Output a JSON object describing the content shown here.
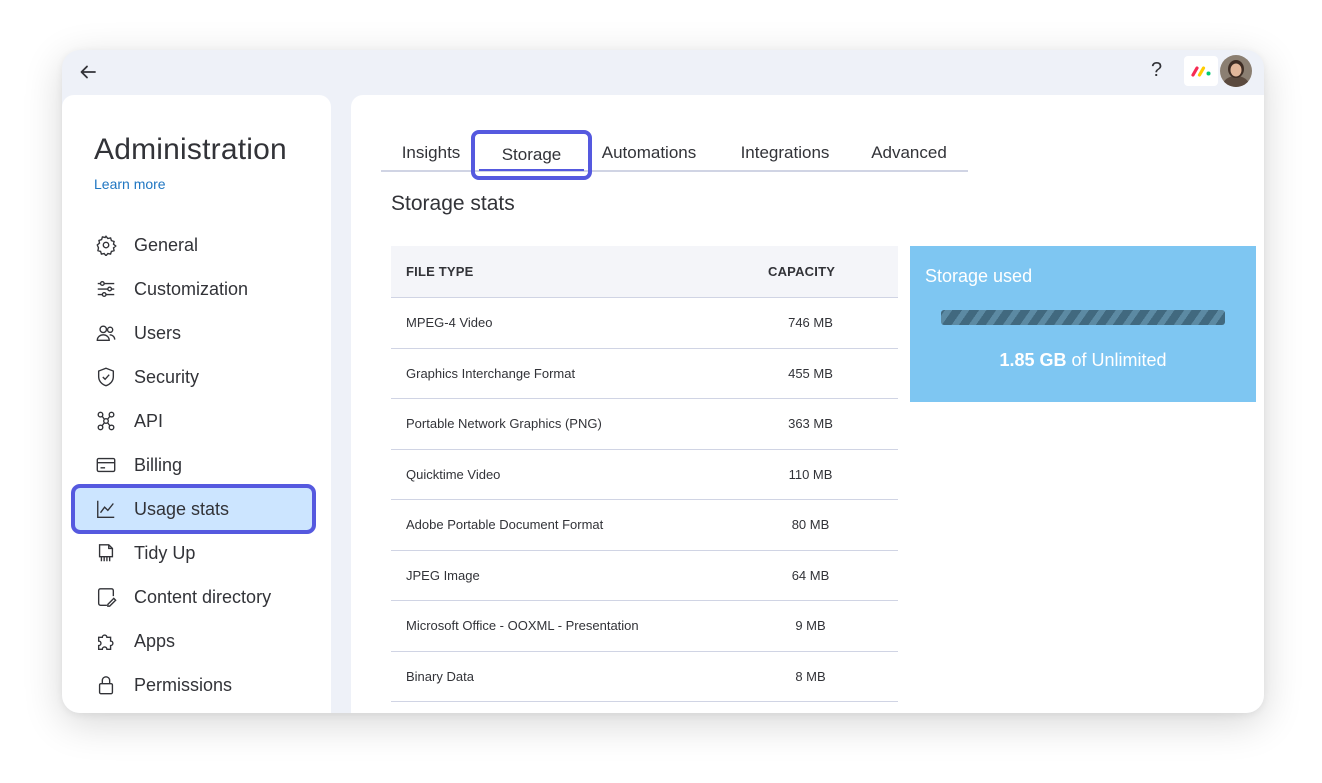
{
  "topbar": {
    "help_label": "?"
  },
  "sidebar": {
    "title": "Administration",
    "learn_more": "Learn more",
    "items": [
      {
        "label": "General",
        "icon": "gear-icon"
      },
      {
        "label": "Customization",
        "icon": "sliders-icon"
      },
      {
        "label": "Users",
        "icon": "users-icon"
      },
      {
        "label": "Security",
        "icon": "shield-icon"
      },
      {
        "label": "API",
        "icon": "api-icon"
      },
      {
        "label": "Billing",
        "icon": "credit-card-icon"
      },
      {
        "label": "Usage stats",
        "icon": "chart-icon",
        "active": true
      },
      {
        "label": "Tidy Up",
        "icon": "tidy-up-icon"
      },
      {
        "label": "Content directory",
        "icon": "content-directory-icon"
      },
      {
        "label": "Apps",
        "icon": "puzzle-icon"
      },
      {
        "label": "Permissions",
        "icon": "lock-icon"
      }
    ]
  },
  "main": {
    "tabs": [
      {
        "label": "Insights"
      },
      {
        "label": "Storage",
        "active": true
      },
      {
        "label": "Automations"
      },
      {
        "label": "Integrations"
      },
      {
        "label": "Advanced"
      }
    ],
    "section_title": "Storage stats",
    "table": {
      "headers": {
        "type": "FILE TYPE",
        "capacity": "CAPACITY"
      },
      "rows": [
        {
          "type": "MPEG-4 Video",
          "capacity": "746 MB"
        },
        {
          "type": "Graphics Interchange Format",
          "capacity": "455 MB"
        },
        {
          "type": "Portable Network Graphics (PNG)",
          "capacity": "363 MB"
        },
        {
          "type": "Quicktime Video",
          "capacity": "110 MB"
        },
        {
          "type": "Adobe Portable Document Format",
          "capacity": "80 MB"
        },
        {
          "type": "JPEG Image",
          "capacity": "64 MB"
        },
        {
          "type": "Microsoft Office - OOXML - Presentation",
          "capacity": "9 MB"
        },
        {
          "type": "Binary Data",
          "capacity": "8 MB"
        }
      ]
    },
    "storage_card": {
      "title": "Storage used",
      "used": "1.85 GB",
      "of_text": " of Unlimited"
    }
  },
  "colors": {
    "accent_outline": "#5559df",
    "active_bg": "#cce5ff",
    "storage_card_bg": "#7ec6f2",
    "link": "#1f76c2"
  }
}
